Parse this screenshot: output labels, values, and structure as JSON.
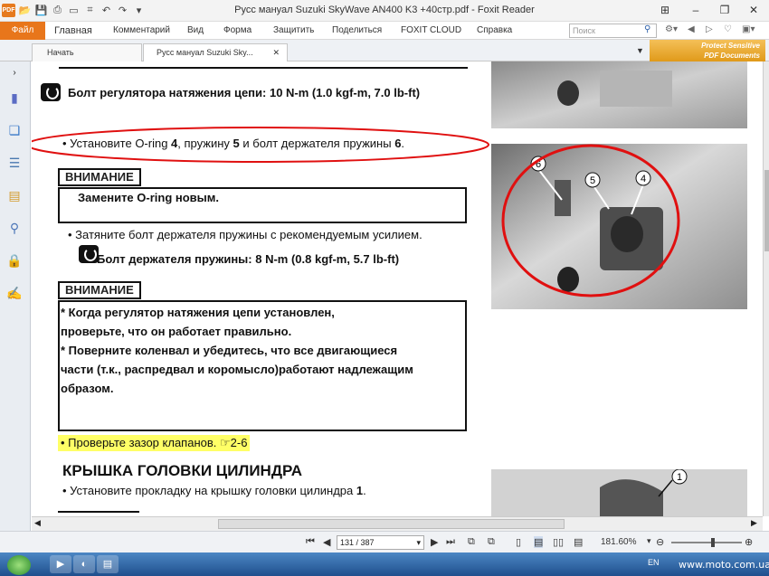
{
  "titlebar": {
    "title": "Русс мануал Suzuki SkyWave AN400 K3 +40стр.pdf - Foxit Reader",
    "pdf_icon": "PDF"
  },
  "ribbon": {
    "file": "Файл",
    "tabs": [
      "Главная",
      "Комментарий",
      "Вид",
      "Форма",
      "Защитить",
      "Поделиться",
      "FOXIT CLOUD",
      "Справка"
    ],
    "search_placeholder": "Поиск"
  },
  "doctabs": {
    "tabs": [
      "Начать",
      "Русс мануал Suzuki Sky..."
    ],
    "close": "✕"
  },
  "protect_badge": [
    "Protect Sensitive",
    "PDF Documents"
  ],
  "document": {
    "torque1_label": "Болт регулятора натяжения цепи: 10 N-m (1.0 kgf-m, 7.0 lb-ft)",
    "install_line": {
      "prefix": "• Установите O-ring ",
      "n1": "4",
      "mid1": ", пружину ",
      "n2": "5",
      "mid2": " и болт держателя пружины ",
      "n3": "6",
      "end": "."
    },
    "caution1_title": "ВНИМАНИЕ",
    "caution1_text": "Замените O-ring новым.",
    "tighten_line": "• Затяните болт держателя пружины с рекомендуемым усилием.",
    "torque2_label": "Болт держателя пружины: 8 N-m (0.8 kgf-m, 5.7 lb-ft)",
    "caution2_title": "ВНИМАНИЕ",
    "caution2_lines": [
      "*        Когда      регулятор      натяжения      цепи      установлен,",
      "проверьте, что он работает правильно.",
      "*        Поверните коленвал и убедитесь, что все двигающиеся",
      "части (т.к., распредвал и коромысло)работают надлежащим",
      "образом."
    ],
    "valve_check": "•  Проверьте зазор клапанов.",
    "valve_ref": "2-6",
    "section_title": "КРЫШКА ГОЛОВКИ ЦИЛИНДРА",
    "gasket_line": {
      "text": "•  Установите прокладку на крышку головки цилиндра ",
      "n": "1",
      "end": "."
    },
    "callouts": [
      "6",
      "5",
      "4"
    ],
    "callout_bottom": "1"
  },
  "statusbar": {
    "page": "131 / 387",
    "zoom": "181.60%"
  },
  "taskbar": {
    "lang": "EN",
    "watermark": "www.moto.com.ua"
  },
  "colors": {
    "accent": "#e8761b",
    "highlight": "#ffff66",
    "annotation": "#e01010"
  }
}
